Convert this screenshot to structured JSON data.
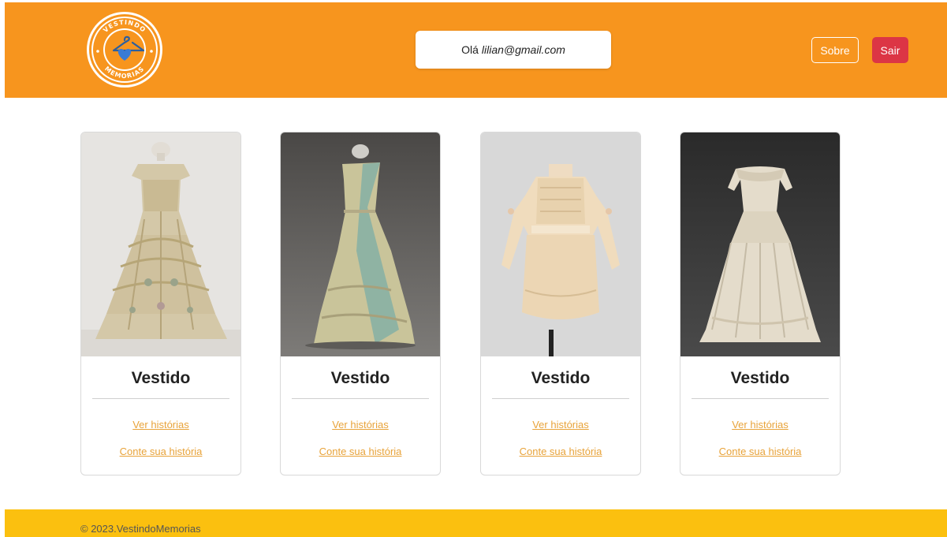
{
  "header": {
    "logo_top_text": "VESTINDO",
    "logo_bottom_text": "MEMORIAS",
    "greeting_prefix": "Olá",
    "greeting_email": "lilian@gmail.com",
    "sobre_label": "Sobre",
    "sair_label": "Sair"
  },
  "colors": {
    "header_bg": "#f7951e",
    "footer_bg": "#fbc00f",
    "link": "#e8a33a",
    "danger": "#dc3545"
  },
  "cards": [
    {
      "title": "Vestido",
      "link_view": "Ver histórias",
      "link_tell": "Conte sua história"
    },
    {
      "title": "Vestido",
      "link_view": "Ver histórias",
      "link_tell": "Conte sua história"
    },
    {
      "title": "Vestido",
      "link_view": "Ver histórias",
      "link_tell": "Conte sua história"
    },
    {
      "title": "Vestido",
      "link_view": "Ver histórias",
      "link_tell": "Conte sua história"
    }
  ],
  "footer": {
    "copyright": "© 2023.VestindoMemorias"
  }
}
